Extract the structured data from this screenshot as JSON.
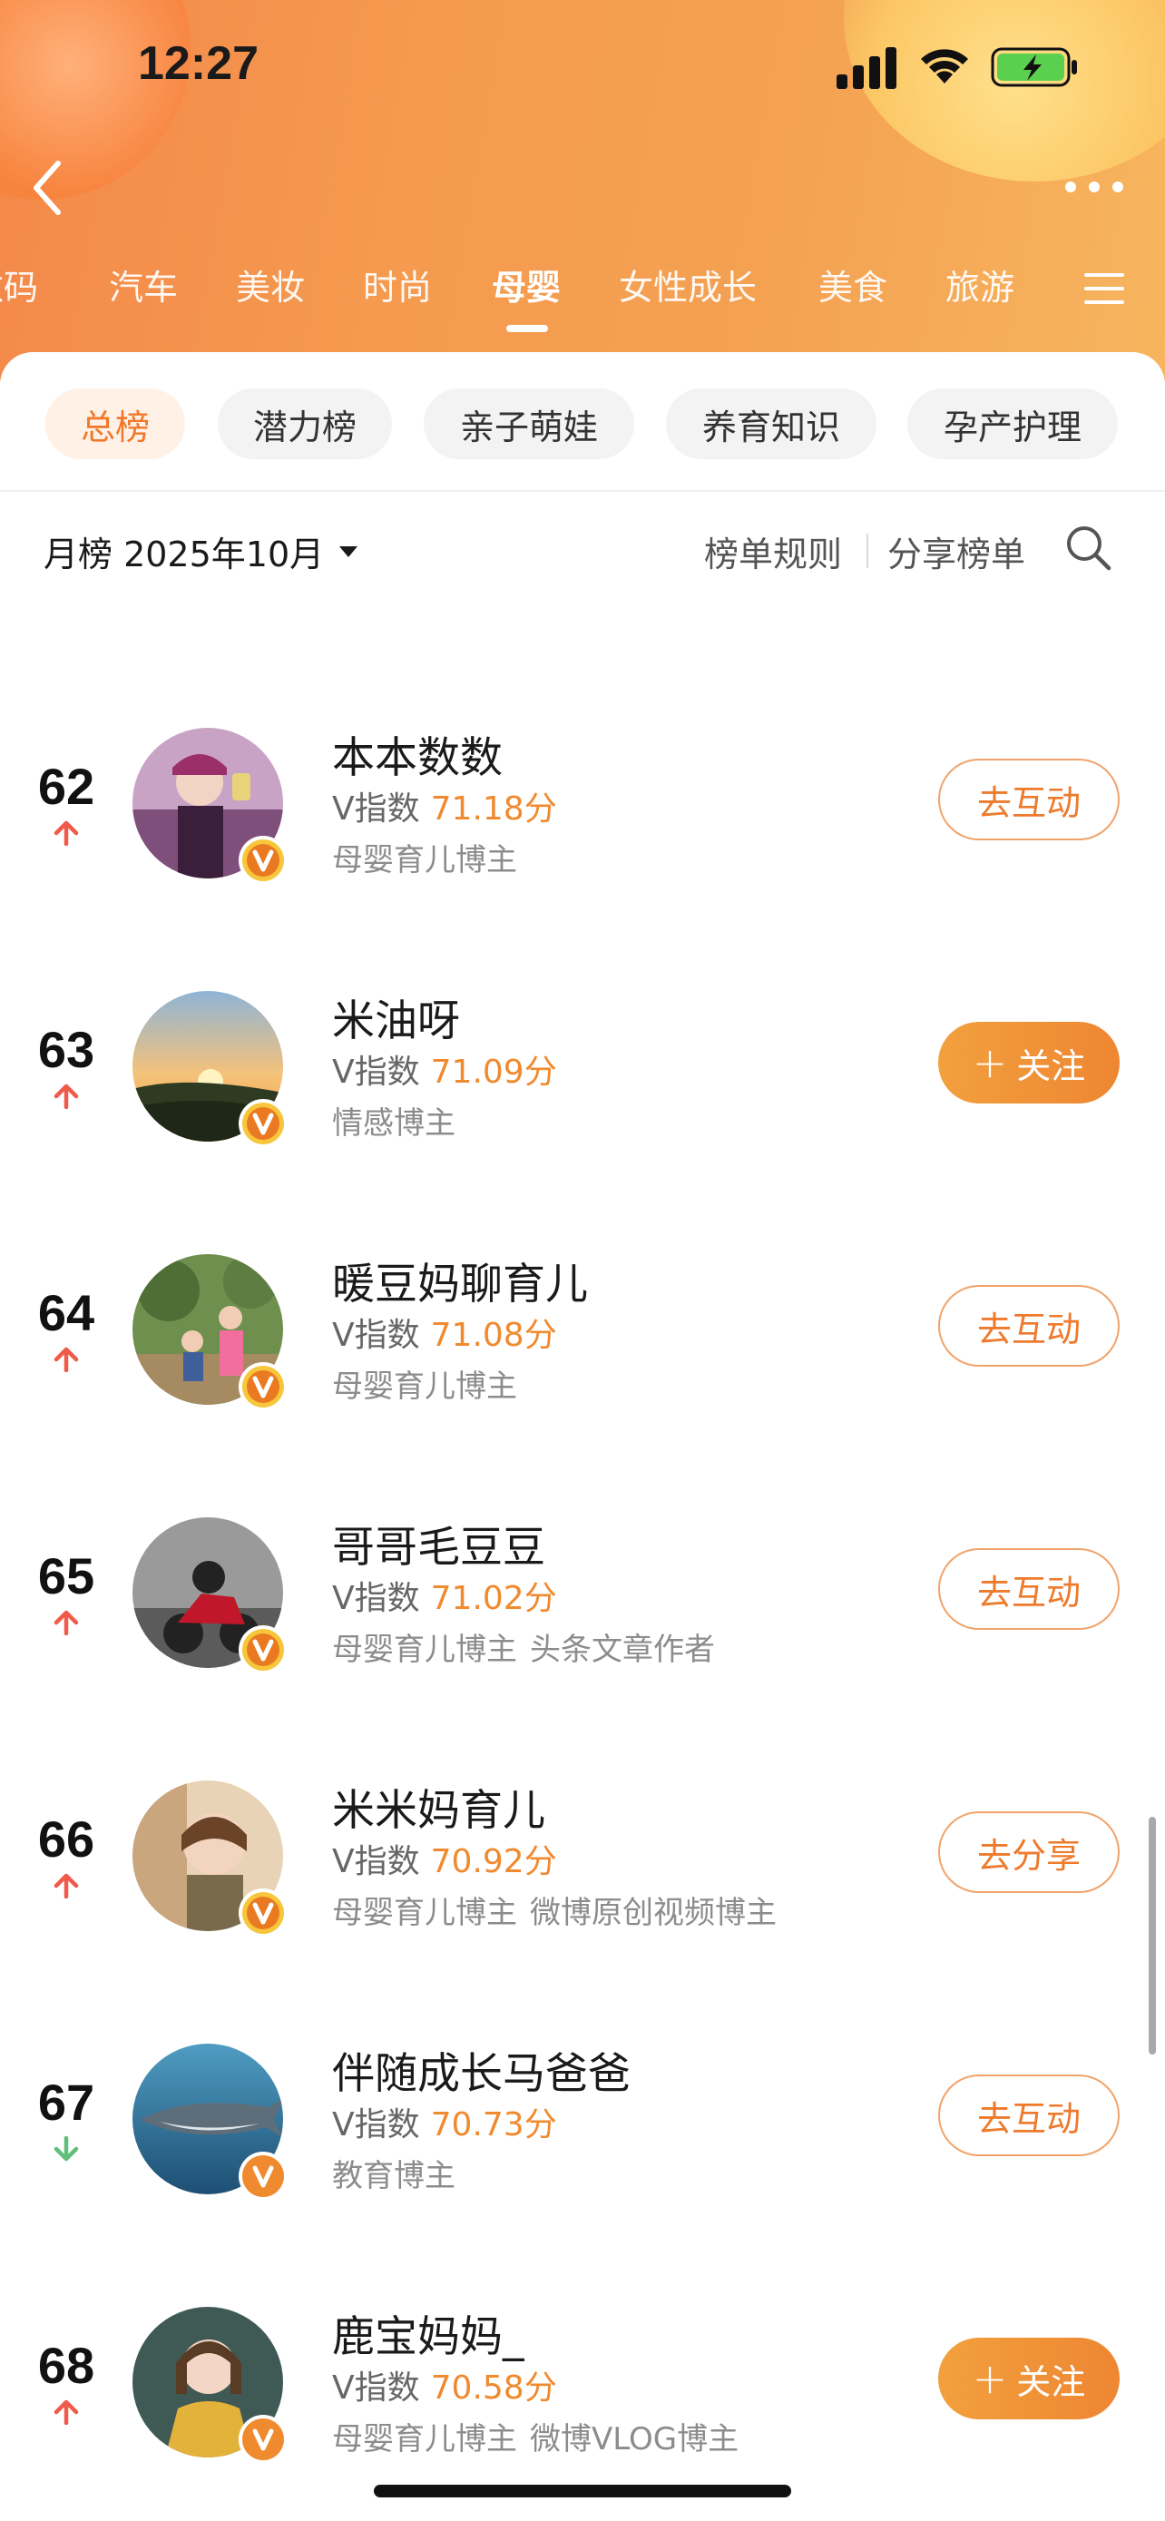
{
  "status_bar": {
    "time": "12:27"
  },
  "category_tabs": [
    {
      "label": "数码",
      "active": false
    },
    {
      "label": "汽车",
      "active": false
    },
    {
      "label": "美妆",
      "active": false
    },
    {
      "label": "时尚",
      "active": false
    },
    {
      "label": "母婴",
      "active": true
    },
    {
      "label": "女性成长",
      "active": false
    },
    {
      "label": "美食",
      "active": false
    },
    {
      "label": "旅游",
      "active": false
    }
  ],
  "sub_tabs": [
    {
      "label": "总榜",
      "active": true
    },
    {
      "label": "潜力榜",
      "active": false
    },
    {
      "label": "亲子萌娃",
      "active": false
    },
    {
      "label": "养育知识",
      "active": false
    },
    {
      "label": "孕产护理",
      "active": false
    }
  ],
  "toolbar": {
    "month_label": "月榜 2025年10月",
    "rules_label": "榜单规则",
    "share_label": "分享榜单"
  },
  "index_prefix": "V指数",
  "rankings": [
    {
      "rank": "62",
      "trend": "up",
      "name": "本本数数",
      "score": "71.18分",
      "tags": [
        "母婴育儿博主"
      ],
      "action": "去互动",
      "action_type": "outline"
    },
    {
      "rank": "63",
      "trend": "up",
      "name": "米油呀",
      "score": "71.09分",
      "tags": [
        "情感博主"
      ],
      "action": "关注",
      "action_type": "follow"
    },
    {
      "rank": "64",
      "trend": "up",
      "name": "暖豆妈聊育儿",
      "score": "71.08分",
      "tags": [
        "母婴育儿博主"
      ],
      "action": "去互动",
      "action_type": "outline"
    },
    {
      "rank": "65",
      "trend": "up",
      "name": "哥哥毛豆豆",
      "score": "71.02分",
      "tags": [
        "母婴育儿博主",
        "头条文章作者"
      ],
      "action": "去互动",
      "action_type": "outline"
    },
    {
      "rank": "66",
      "trend": "up",
      "name": "米米妈育儿",
      "score": "70.92分",
      "tags": [
        "母婴育儿博主",
        "微博原创视频博主"
      ],
      "action": "去分享",
      "action_type": "outline"
    },
    {
      "rank": "67",
      "trend": "down",
      "name": "伴随成长马爸爸",
      "score": "70.73分",
      "tags": [
        "教育博主"
      ],
      "action": "去互动",
      "action_type": "outline"
    },
    {
      "rank": "68",
      "trend": "up",
      "name": "鹿宝妈妈_",
      "score": "70.58分",
      "tags": [
        "母婴育儿博主",
        "微博VLOG博主"
      ],
      "action": "关注",
      "action_type": "follow"
    }
  ],
  "colors": {
    "accent": "#f08a2f",
    "badge_yellow": "#f7c63a",
    "badge_orange": "#f08a2f",
    "trend_up": "#f05a4a",
    "trend_down": "#5fbf7a"
  }
}
